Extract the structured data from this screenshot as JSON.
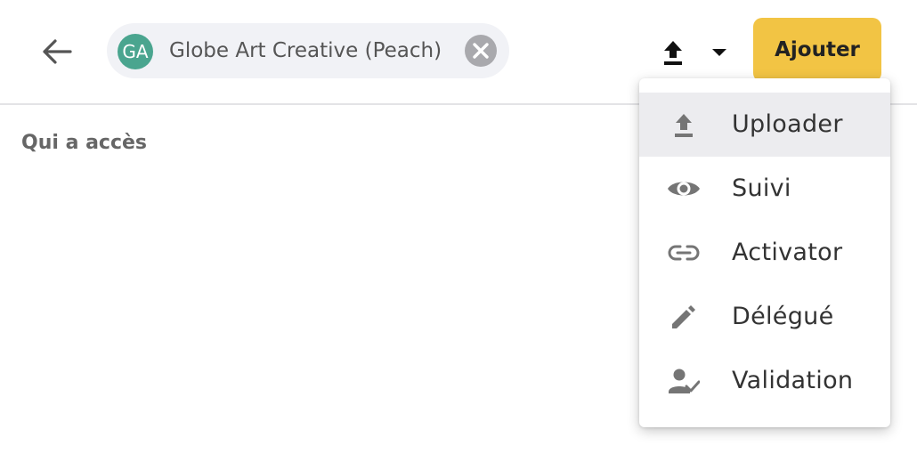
{
  "header": {
    "chip": {
      "initials": "GA",
      "label": "Globe Art Creative (Peach)"
    },
    "add_button": "Ajouter"
  },
  "section": {
    "title": "Qui a accès"
  },
  "menu": {
    "items": [
      {
        "label": "Uploader",
        "icon": "upload-icon"
      },
      {
        "label": "Suivi",
        "icon": "eye-icon"
      },
      {
        "label": "Activator",
        "icon": "link-icon"
      },
      {
        "label": "Délégué",
        "icon": "pencil-icon"
      },
      {
        "label": "Validation",
        "icon": "user-check-icon"
      }
    ]
  },
  "colors": {
    "accent": "#f2c444",
    "avatar": "#4aa58f",
    "chip_bg": "#f1f2f6"
  }
}
